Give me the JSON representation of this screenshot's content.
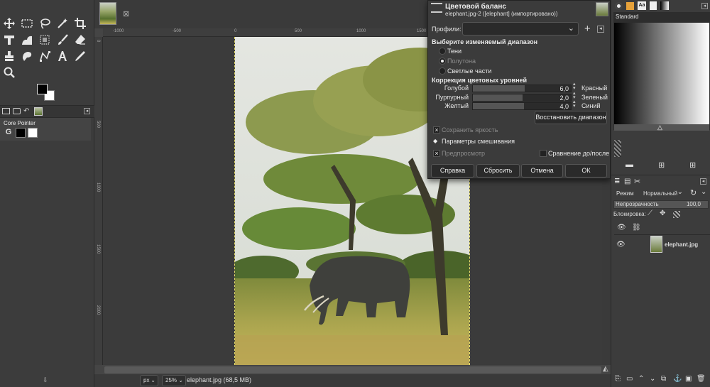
{
  "toolbox": {
    "tools": [
      "move-tool",
      "rect-select-tool",
      "lasso-tool",
      "fuzzy-select-tool",
      "crop-tool",
      "transform-tool",
      "warp-tool",
      "cage-tool",
      "paintbrush-tool",
      "eraser-tool",
      "clone-tool",
      "smudge-tool",
      "path-tool",
      "text-tool",
      "color-picker-tool",
      "zoom-tool"
    ],
    "core_pointer_label": "Core Pointer",
    "core_pointer_letter": "G"
  },
  "canvas": {
    "ruler_top_labels": [
      "-1000",
      "-500",
      "0",
      "500",
      "1000",
      "1500"
    ],
    "ruler_left_labels": [
      "0",
      "500",
      "1000",
      "1500",
      "2000"
    ],
    "status_unit": "px",
    "status_zoom": "25%",
    "status_file": "elephant.jpg (68,5 MB)"
  },
  "dialog": {
    "title": "Цветовой баланс",
    "subtitle": "elephant.jpg-2 ([elephant] (импортировано))",
    "profiles_label": "Профили:",
    "profiles_value": "",
    "range_heading": "Выберите изменяемый диапазон",
    "range_options": [
      {
        "label": "Тени",
        "selected": false
      },
      {
        "label": "Полутона",
        "selected": true
      },
      {
        "label": "Светлые части",
        "selected": false
      }
    ],
    "correction_heading": "Коррекция цветовых уровней",
    "sliders": [
      {
        "left": "Голубой",
        "right": "Красный",
        "value": "6,0",
        "level": 0.53
      },
      {
        "left": "Пурпурный",
        "right": "Зеленый",
        "value": "2,0",
        "level": 0.51
      },
      {
        "left": "Желтый",
        "right": "Синий",
        "value": "4,0",
        "level": 0.52
      }
    ],
    "reset_range_label": "Восстановить диапазон",
    "preserve_luminosity_label": "Сохранить яркость",
    "blend_options_label": "Параметры смешивания",
    "preview_label": "Предпросмотр",
    "split_view_label": "Сравнение до/после",
    "buttons": {
      "help": "Справка",
      "reset": "Сбросить",
      "cancel": "Отмена",
      "ok": "ОК"
    }
  },
  "right_panel": {
    "gradient_name": "Standard",
    "mode_label": "Режим",
    "mode_value": "Нормальный",
    "opacity_label": "Непрозрачность",
    "opacity_value": "100,0",
    "lock_label": "Блокировка:",
    "layer_name": "elephant.jpg"
  },
  "colors": {
    "accent": "#e8e06a",
    "dialog_bg": "#3b3b3b",
    "panel_bg": "#3c3c3c"
  }
}
